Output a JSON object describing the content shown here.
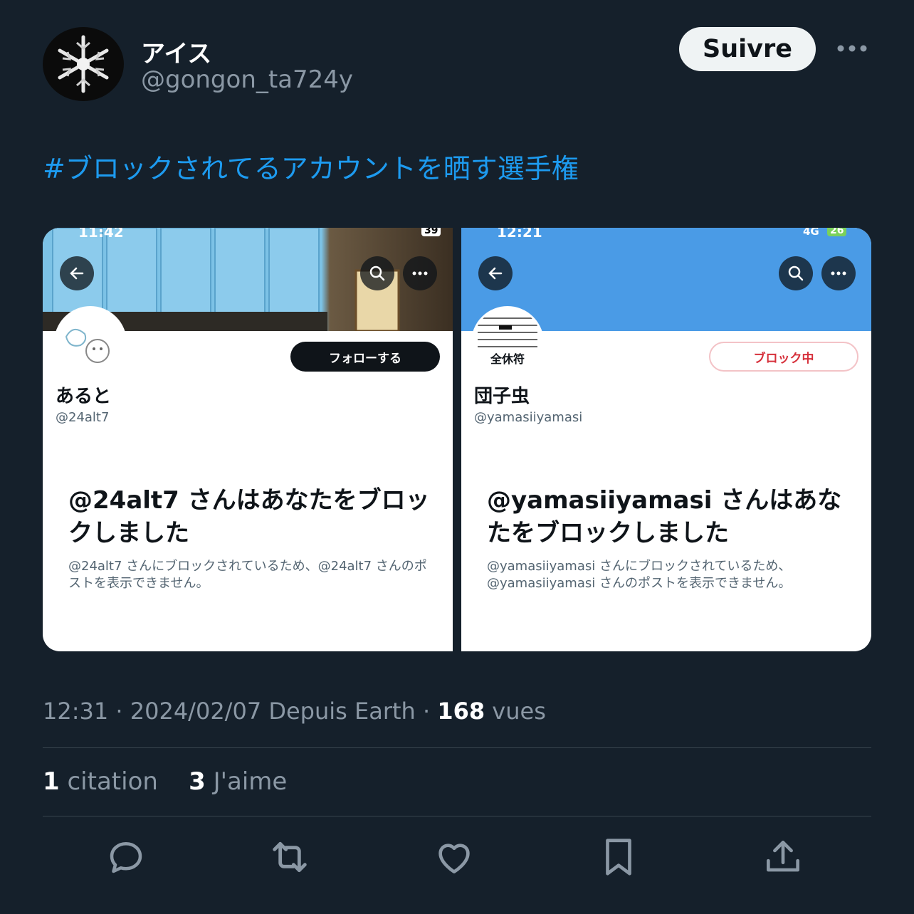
{
  "author": {
    "name": "アイス",
    "handle": "@gongon_ta724y"
  },
  "follow_label": "Suivre",
  "hashtag": "#ブロックされてるアカウントを晒す選手権",
  "shots": [
    {
      "status_time": "11:42",
      "battery": "39",
      "banner_color": "#6fb6dc",
      "button_label": "フォローする",
      "pfp_caption": "",
      "display_name": "あると",
      "handle": "@24alt7",
      "block_title": "@24alt7 さんはあなたをブロックしました",
      "block_sub": "@24alt7 さんにブロックされているため、@24alt7 さんのポストを表示できません。"
    },
    {
      "status_time": "12:21",
      "network": "4G",
      "battery": "26",
      "banner_color": "#4a9be6",
      "button_label": "ブロック中",
      "pfp_caption": "全休符",
      "display_name": "団子虫",
      "handle": "@yamasiiyamasi",
      "block_title": "@yamasiiyamasi さんはあなたをブロックしました",
      "block_sub": "@yamasiiyamasi さんにブロックされているため、@yamasiiyamasi さんのポストを表示できません。"
    }
  ],
  "meta": {
    "time": "12:31",
    "date": "2024/02/07",
    "source": "Depuis Earth",
    "views": "168",
    "views_label": "vues"
  },
  "stats": {
    "quotes": "1",
    "quotes_label": "citation",
    "likes": "3",
    "likes_label": "J'aime"
  },
  "colors": {
    "background": "#15202b",
    "accent": "#1d9bf0",
    "muted": "#8b98a5",
    "divider": "#38444d"
  },
  "icons": [
    "reply-icon",
    "retweet-icon",
    "like-icon",
    "bookmark-icon",
    "share-icon"
  ]
}
